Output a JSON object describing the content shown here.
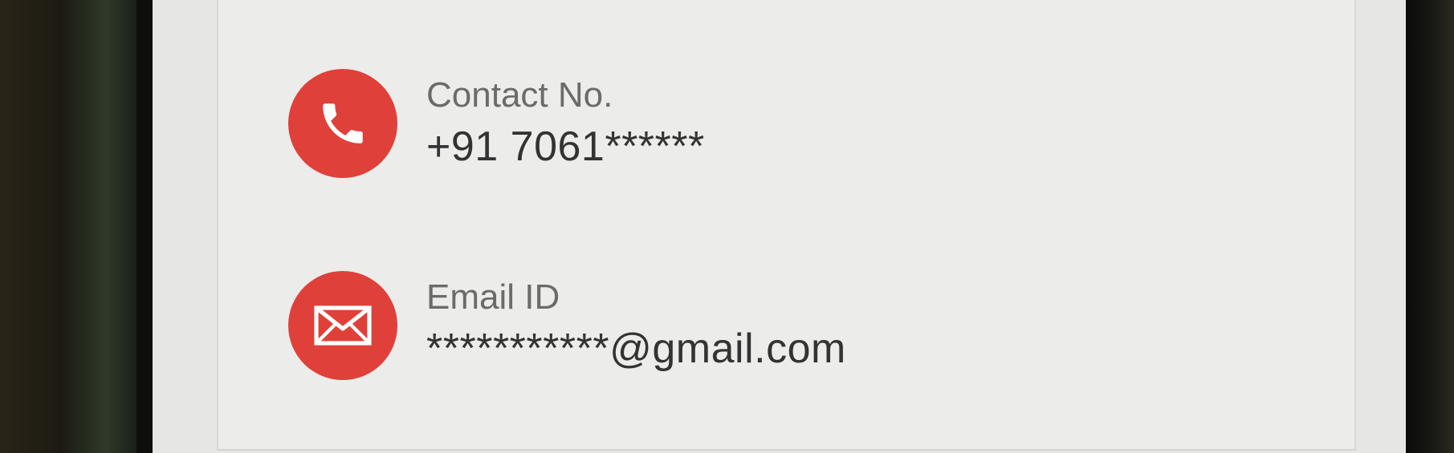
{
  "contact": {
    "icon": "phone-icon",
    "label": "Contact No.",
    "value": "+91 7061******"
  },
  "email": {
    "icon": "mail-icon",
    "label": "Email ID",
    "value": "***********@gmail.com"
  },
  "colors": {
    "accent": "#e0403a",
    "label_text": "#6b6b6b",
    "value_text": "#333333",
    "card_background": "#ececea"
  }
}
